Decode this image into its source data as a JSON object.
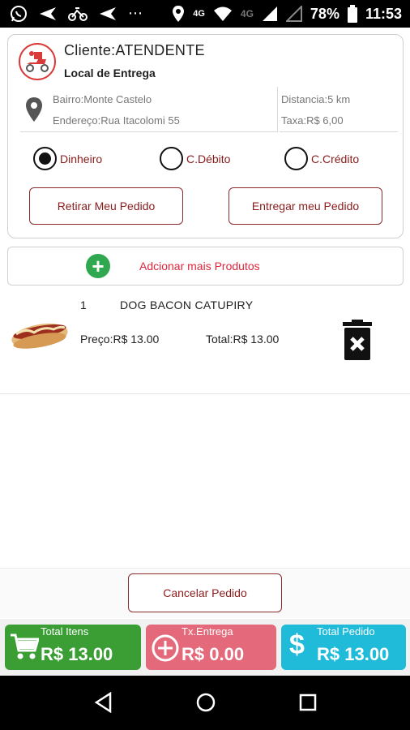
{
  "status_bar": {
    "network": "4G",
    "network_secondary": "4G",
    "battery": "78%",
    "time": "11:53",
    "icons": [
      "whatsapp-icon",
      "send-icon",
      "bike-icon",
      "send-icon",
      "more-icon",
      "location-icon",
      "wifi-icon",
      "signal-icon",
      "battery-icon"
    ]
  },
  "order": {
    "client_label": "Cliente:ATENDENTE",
    "delivery_title": "Local de Entrega",
    "bairro": "Bairro:Monte Castelo",
    "endereco": "Endereço:Rua Itacolomi 55",
    "distancia": "Distancia:5 km",
    "taxa": "Taxa:R$ 6,00"
  },
  "payment": {
    "options": [
      "Dinheiro",
      "C.Débito",
      "C.Crédito"
    ],
    "selected": "Dinheiro"
  },
  "actions": {
    "pickup": "Retirar Meu Pedido",
    "deliver": "Entregar meu Pedido",
    "add_products": "Adcionar mais Produtos",
    "cancel": "Cancelar Pedido"
  },
  "items": [
    {
      "qty": "1",
      "name": "DOG BACON CATUPIRY",
      "price": "Preço:R$ 13.00",
      "total": "Total:R$ 13.00"
    }
  ],
  "totals": {
    "items_label": "Total Itens",
    "items_value": "R$ 13.00",
    "fee_label": "Tx.Entrega",
    "fee_value": "R$ 0.00",
    "order_label": "Total Pedido",
    "order_value": "R$ 13.00"
  },
  "colors": {
    "accent_text": "#8b1c1c",
    "add_text": "#e0253d",
    "green": "#3b9e35",
    "pink": "#e46a7b",
    "cyan": "#1fbbd9"
  }
}
